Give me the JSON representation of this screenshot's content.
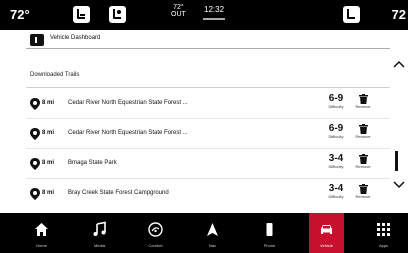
{
  "status_bar": {
    "temp_left": "72°",
    "temp_right": "72",
    "outside_temp": "72°",
    "outside_label": "OUT",
    "time": "12:32"
  },
  "header": {
    "title": "Vehicle Dashboard"
  },
  "section": {
    "title": "Downloaded Trails"
  },
  "trails": [
    {
      "distance": "8 mi",
      "name": "Cedar River North Equestrian State Forest ...",
      "difficulty": "6-9",
      "difficulty_label": "Difficulty",
      "remove_label": "Remove"
    },
    {
      "distance": "8 mi",
      "name": "Cedar River North Equestrian State Forest ...",
      "difficulty": "6-9",
      "difficulty_label": "Difficulty",
      "remove_label": "Remove"
    },
    {
      "distance": "8 mi",
      "name": "Bmaga State Park",
      "difficulty": "3-4",
      "difficulty_label": "Difficulty",
      "remove_label": "Remove"
    },
    {
      "distance": "8 mi",
      "name": "Bray Creek State Forest Campground",
      "difficulty": "3-4",
      "difficulty_label": "Difficulty",
      "remove_label": "Remove"
    }
  ],
  "nav": {
    "items": [
      {
        "label": "Home",
        "icon": "home-icon"
      },
      {
        "label": "Media",
        "icon": "music-note-icon"
      },
      {
        "label": "Comfort",
        "icon": "comfort-icon"
      },
      {
        "label": "Nav",
        "icon": "navigation-arrow-icon"
      },
      {
        "label": "Phone",
        "icon": "phone-icon"
      },
      {
        "label": "Vehicle",
        "icon": "vehicle-icon"
      },
      {
        "label": "Apps",
        "icon": "apps-grid-icon"
      }
    ],
    "active": "Vehicle"
  },
  "colors": {
    "accent": "#c8102e",
    "bar": "#000000"
  }
}
